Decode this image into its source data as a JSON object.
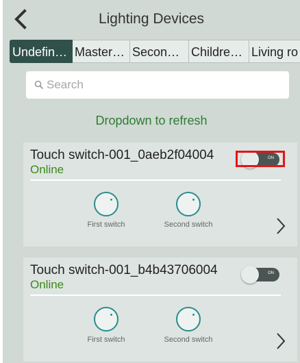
{
  "header": {
    "title": "Lighting Devices",
    "back_icon": "chevron-left-icon"
  },
  "tabs": [
    {
      "label": "Undefin…",
      "active": true
    },
    {
      "label": "Master …",
      "active": false
    },
    {
      "label": "Second …",
      "active": false
    },
    {
      "label": "Children…",
      "active": false
    },
    {
      "label": "Living ro",
      "active": false
    }
  ],
  "search": {
    "placeholder": "Search",
    "icon": "search-icon"
  },
  "refresh_hint": "Dropdown to refresh",
  "devices": [
    {
      "name": "Touch switch-001_0aeb2f04004",
      "status": "Online",
      "toggle_label": "ON",
      "toggle_on": true,
      "highlighted": true,
      "switches": [
        "First switch",
        "Second switch"
      ]
    },
    {
      "name": "Touch switch-001_b4b43706004",
      "status": "Online",
      "toggle_label": "ON",
      "toggle_on": true,
      "highlighted": false,
      "switches": [
        "First switch",
        "Second switch"
      ]
    }
  ],
  "colors": {
    "active_tab": "#30504a",
    "status_online": "#3b8a18",
    "refresh_hint": "#2e7d32",
    "switch_ring": "#2a8c8c",
    "highlight_box": "#e31515"
  }
}
